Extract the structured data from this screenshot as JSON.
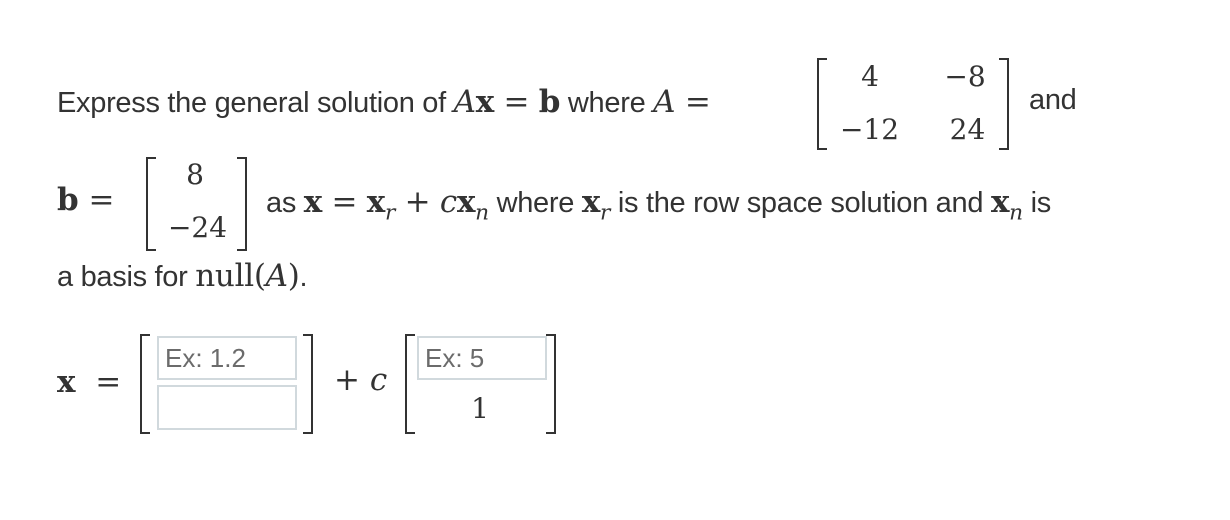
{
  "problem": {
    "line1": {
      "prefix": "Express the general solution of",
      "equation_A": "A",
      "equation_x": "x",
      "equals": "=",
      "equation_b": "b",
      "where": "where",
      "A_label": "A",
      "A_equals": "=",
      "and": "and"
    },
    "matrix_A": [
      [
        "4",
        "−8"
      ],
      [
        "−12",
        "24"
      ]
    ],
    "line2": {
      "b_label": "b",
      "b_equals": "=",
      "as": "as",
      "x": "x",
      "eq": "=",
      "xr": "x",
      "xr_sub": "r",
      "plus": "+",
      "c": "c",
      "xn": "x",
      "xn_sub": "n",
      "where": "where",
      "xr2": "x",
      "xr2_sub": "r",
      "mid": "is the row space solution and",
      "xn2": "x",
      "xn2_sub": "n",
      "is": "is"
    },
    "vector_b": [
      "8",
      "−24"
    ],
    "line3": {
      "prefix": "a basis for",
      "null": "null",
      "open": "(",
      "A": "A",
      "close": ")",
      "period": "."
    }
  },
  "answer": {
    "x_label": "x",
    "equals": "=",
    "xr_inputs": [
      {
        "value": "",
        "placeholder": "Ex: 1.2"
      },
      {
        "value": "",
        "placeholder": ""
      }
    ],
    "plus": "+",
    "c": "c",
    "xn_input": {
      "value": "",
      "placeholder": "Ex: 5"
    },
    "xn_fixed": "1"
  }
}
